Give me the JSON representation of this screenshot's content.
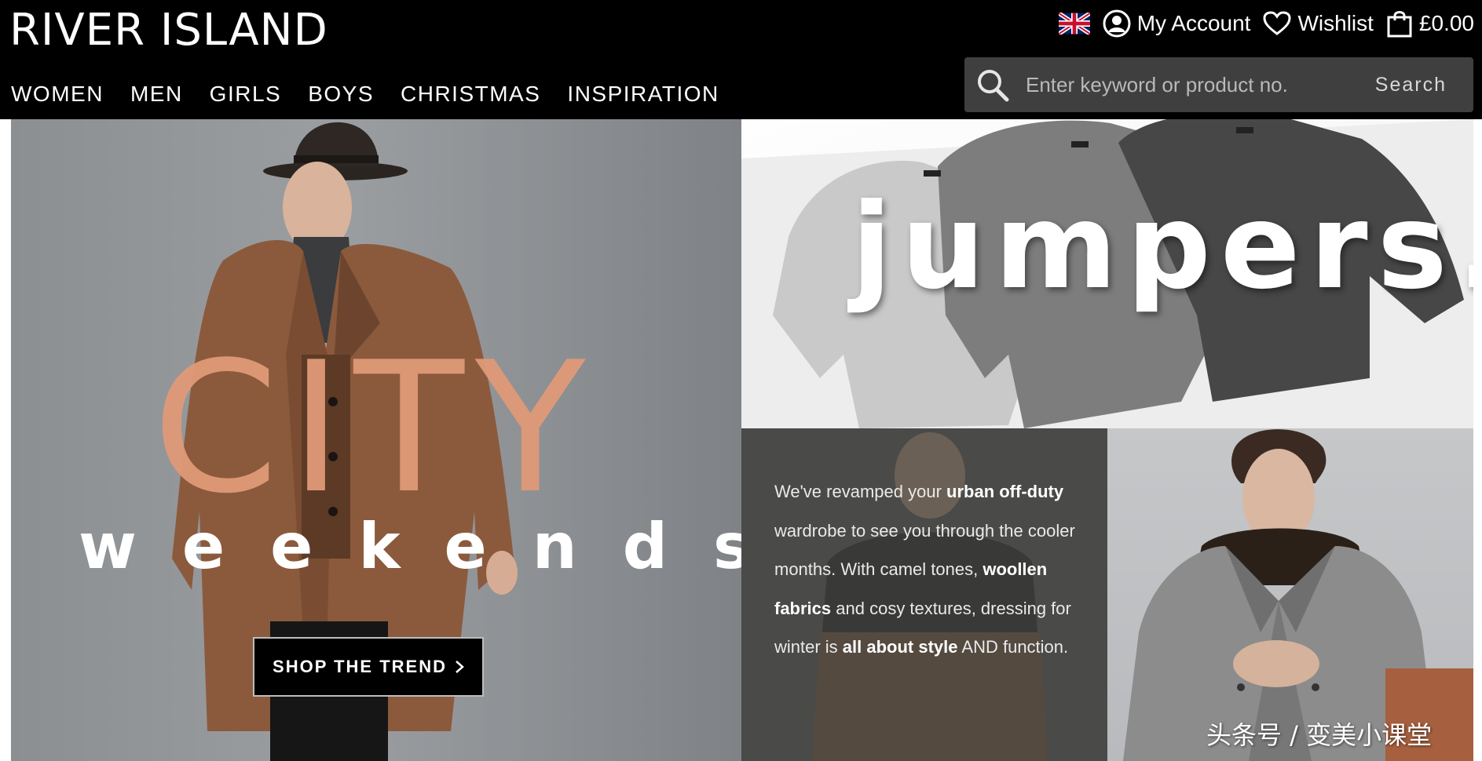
{
  "brand": {
    "name": "RIVER ISLAND"
  },
  "utils": {
    "flag_icon": "uk-flag-icon",
    "account_label": "My Account",
    "wishlist_label": "Wishlist",
    "bag_total": "£0.00"
  },
  "nav": {
    "items": [
      "WOMEN",
      "MEN",
      "GIRLS",
      "BOYS",
      "CHRISTMAS",
      "INSPIRATION"
    ]
  },
  "search": {
    "placeholder": "Enter keyword or product no.",
    "button_label": "Search"
  },
  "hero": {
    "title": "CITY",
    "subtitle": "weekends",
    "cta_label": "SHOP THE TREND",
    "cta_icon": "chevron-right-icon"
  },
  "jumpers": {
    "title": "jumpers."
  },
  "editorial": {
    "segments": [
      {
        "text": "We've revamped your ",
        "bold": false
      },
      {
        "text": "urban off-duty",
        "bold": true
      },
      {
        "text": " wardrobe to see you through the cooler months. With camel tones, ",
        "bold": false
      },
      {
        "text": "woollen fabrics",
        "bold": true
      },
      {
        "text": " and cosy textures, dressing for winter is ",
        "bold": false
      },
      {
        "text": "all about style",
        "bold": true
      },
      {
        "text": " AND function.",
        "bold": false
      }
    ]
  },
  "watermark": "头条号 / 变美小课堂",
  "colors": {
    "header_bg": "#000000",
    "city_accent": "#e09a78",
    "search_bg": "#3f3f3f",
    "editorial_bg": "#4a4a48"
  }
}
